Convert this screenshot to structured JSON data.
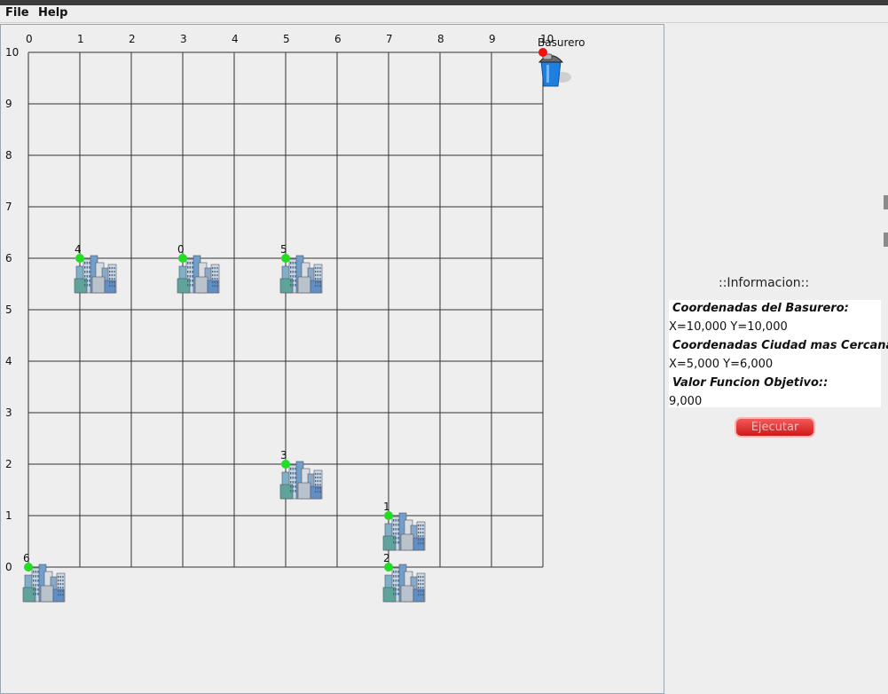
{
  "menu": {
    "file": "File",
    "help": "Help"
  },
  "map": {
    "x_ticks": [
      "0",
      "1",
      "2",
      "3",
      "4",
      "5",
      "6",
      "7",
      "8",
      "9",
      "10"
    ],
    "y_ticks": [
      "10",
      "9",
      "8",
      "7",
      "6",
      "5",
      "4",
      "3",
      "2",
      "1",
      "0"
    ],
    "dump": {
      "label": "Basurero",
      "x": 10,
      "y": 10
    },
    "cities": [
      {
        "id": "0",
        "x": 3,
        "y": 6
      },
      {
        "id": "1",
        "x": 7,
        "y": 1
      },
      {
        "id": "2",
        "x": 7,
        "y": 0
      },
      {
        "id": "3",
        "x": 5,
        "y": 2
      },
      {
        "id": "4",
        "x": 1,
        "y": 6
      },
      {
        "id": "5",
        "x": 5,
        "y": 6
      },
      {
        "id": "6",
        "x": 0,
        "y": 0
      }
    ]
  },
  "info": {
    "title": "::Informacion::",
    "dump_coords_label": "Coordenadas del Basurero:",
    "dump_coords_value": "X=10,000 Y=10,000",
    "nearest_city_label": "Coordenadas Ciudad mas Cercana:",
    "nearest_city_value": "X=5,000 Y=6,000",
    "objective_label": "Valor Funcion Objetivo::",
    "objective_value": "9,000",
    "execute_button": "Ejecutar"
  },
  "colors": {
    "city_marker": "#22dd22",
    "dump_marker": "#ee1111",
    "button": "#dd2222"
  }
}
